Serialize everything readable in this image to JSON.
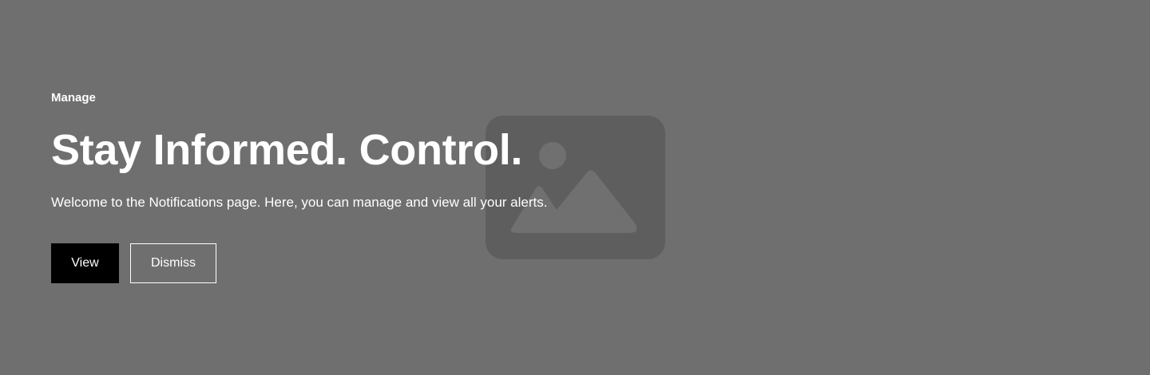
{
  "hero": {
    "eyebrow": "Manage",
    "headline": "Stay Informed. Control.",
    "intro": "Welcome to the Notifications page. Here, you can manage and view all your alerts.",
    "buttons": {
      "view_label": "View",
      "dismiss_label": "Dismiss"
    },
    "image_icon": "image-placeholder-icon"
  },
  "colors": {
    "background": "#6f6f6f",
    "placeholder": "#5e5e5e",
    "text": "#ffffff",
    "primary_button": "#000000"
  }
}
